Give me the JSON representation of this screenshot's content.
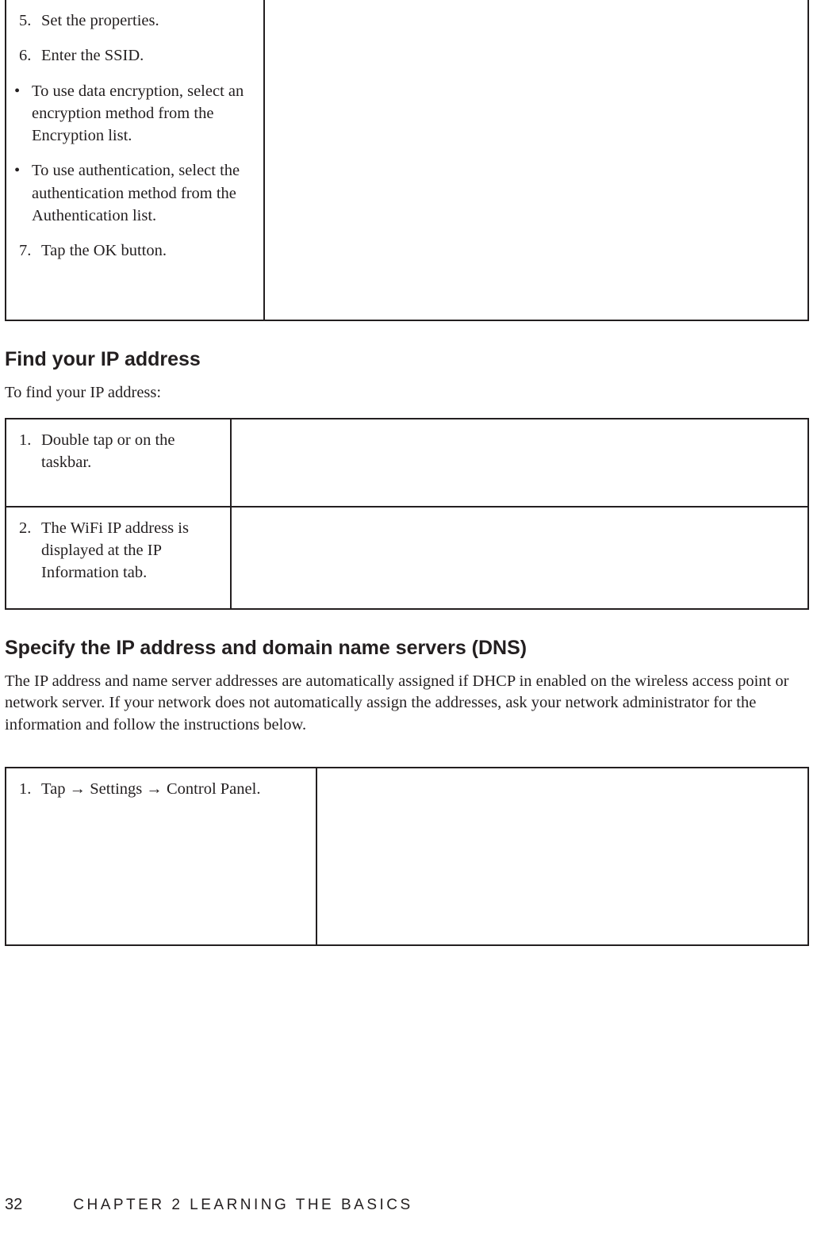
{
  "table1": {
    "items": [
      {
        "marker": "5.",
        "text": "Set the properties.",
        "type": "num"
      },
      {
        "marker": "6.",
        "text": "Enter the SSID.",
        "type": "num"
      },
      {
        "marker": "•",
        "text": "To use data encryption, select an encryption method from the Encryption list.",
        "type": "bul"
      },
      {
        "marker": "•",
        "text": "To use authentication, select the authentication method from the Authentication list.",
        "type": "bul"
      },
      {
        "marker": "7.",
        "text": "Tap the OK button.",
        "type": "num"
      }
    ]
  },
  "section2": {
    "heading": "Find your IP address",
    "intro": "To find your IP address:",
    "rows": [
      {
        "marker": "1.",
        "text": "Double tap  or  on the taskbar."
      },
      {
        "marker": "2.",
        "text": "The WiFi IP address is displayed at the IP Information tab."
      }
    ]
  },
  "section3": {
    "heading": "Specify the IP address and domain name servers (DNS)",
    "intro": "The IP address and name server addresses are automatically assigned if DHCP in enabled on the wireless access point or network server. If your network does not automatically assign the addresses, ask your network administrator for the information and follow the instructions below.",
    "rows": [
      {
        "marker": "1.",
        "text": "Tap  → Settings → Control Panel."
      }
    ]
  },
  "footer": {
    "page": "32",
    "chapter": "CHAPTER 2 LEARNING THE BASICS"
  }
}
